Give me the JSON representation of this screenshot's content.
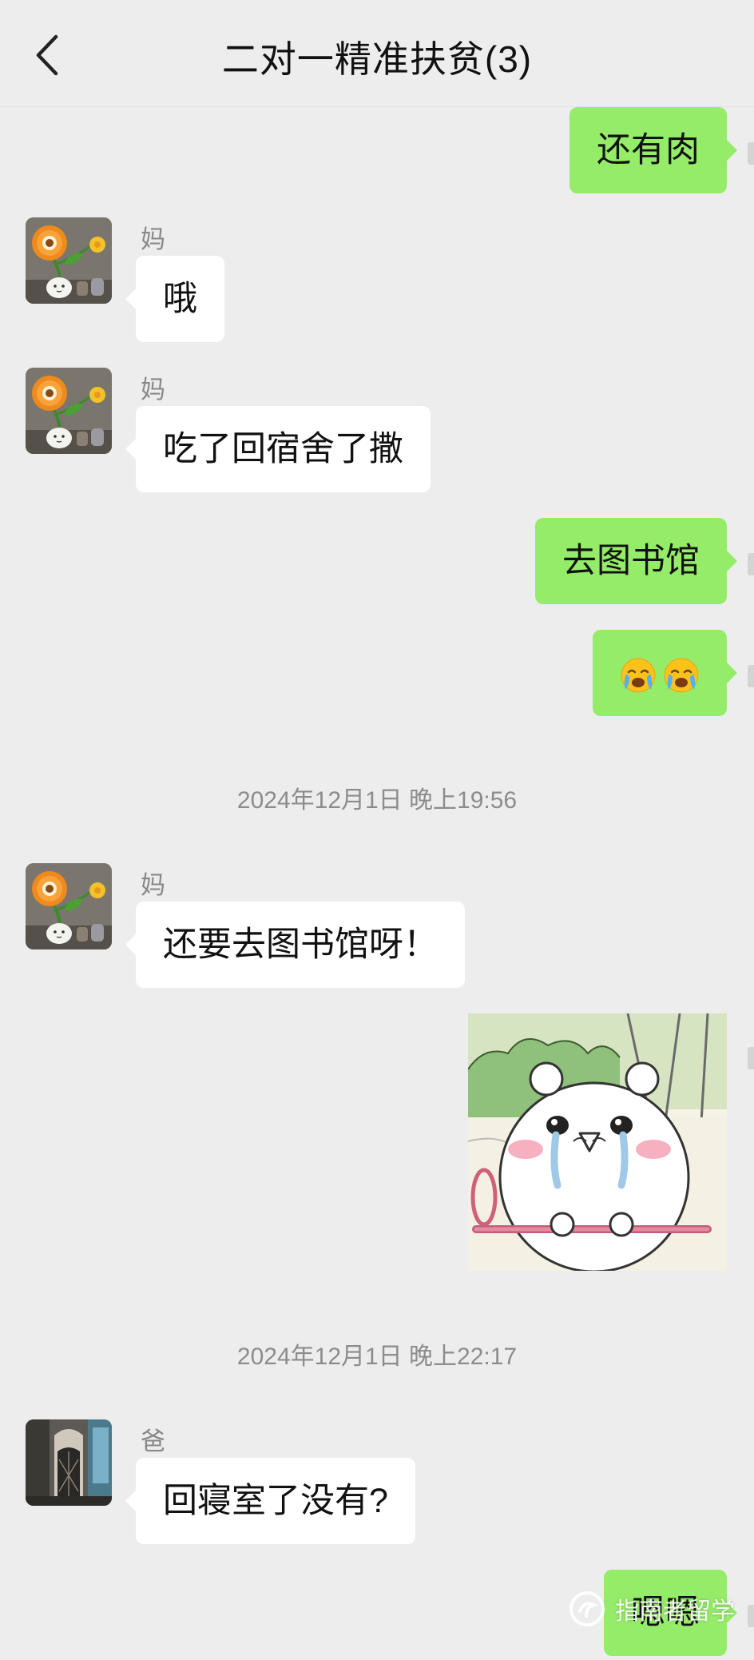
{
  "header": {
    "title": "二对一精准扶贫(3)"
  },
  "messages": {
    "m1": {
      "text": "还有肉"
    },
    "m2": {
      "sender": "妈",
      "text": "哦"
    },
    "m3": {
      "sender": "妈",
      "text": "吃了回宿舍了撒"
    },
    "m4": {
      "text": "去图书馆"
    },
    "m5": {
      "emoji": [
        "crying-face",
        "crying-face"
      ]
    },
    "t1": "2024年12月1日 晚上19:56",
    "m6": {
      "sender": "妈",
      "text": "还要去图书馆呀！"
    },
    "m7": {
      "type": "sticker",
      "description": "crying-hamster-sticker"
    },
    "t2": "2024年12月1日 晚上22:17",
    "m8": {
      "sender": "爸",
      "text": "回寝室了没有?"
    },
    "m9": {
      "text": "嗯嗯"
    }
  },
  "watermark": {
    "text": "指南者留学"
  },
  "colors": {
    "background": "#ededed",
    "outgoing_bubble": "#95ec69",
    "incoming_bubble": "#ffffff",
    "meta_text": "#888888"
  }
}
